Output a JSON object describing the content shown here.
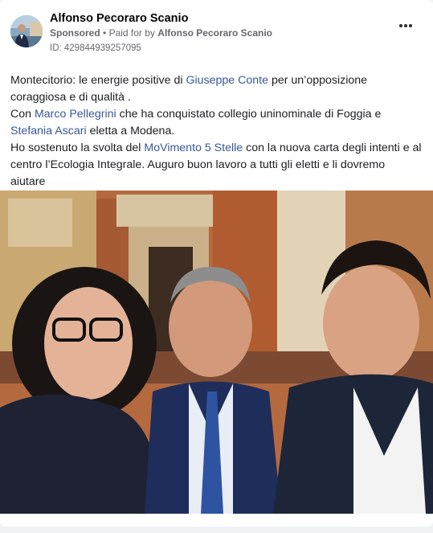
{
  "post": {
    "author": "Alfonso Pecoraro Scanio",
    "sponsored_label": "Sponsored",
    "separator": "•",
    "paid_for_prefix": "Paid for by",
    "paid_for_name": "Alfonso Pecoraro Scanio",
    "id_line": "ID: 429844939257095",
    "more_icon": "more-horizontal-icon",
    "text": {
      "p1_a": "Montecitorio: le energie positive di ",
      "p1_link": "Giuseppe Conte",
      "p1_b": " per un’opposizione coraggiosa e di qualità .",
      "p2_a": "Con ",
      "p2_link1": "Marco Pellegrini",
      "p2_b": " che ha conquistato collegio uninominale di Foggia e ",
      "p2_link2": "Stefania Ascari",
      "p2_c": " eletta a Modena.",
      "p3_a": "Ho sostenuto la svolta del ",
      "p3_link": "MoVimento 5 Stelle",
      "p3_b": " con la nuova carta degli intenti e al centro l’Ecologia Integrale. Auguro buon lavoro a tutti gli eletti e li dovremo aiutare",
      "p4": "...."
    },
    "colors": {
      "link": "#385898",
      "meta": "#65676b"
    }
  }
}
